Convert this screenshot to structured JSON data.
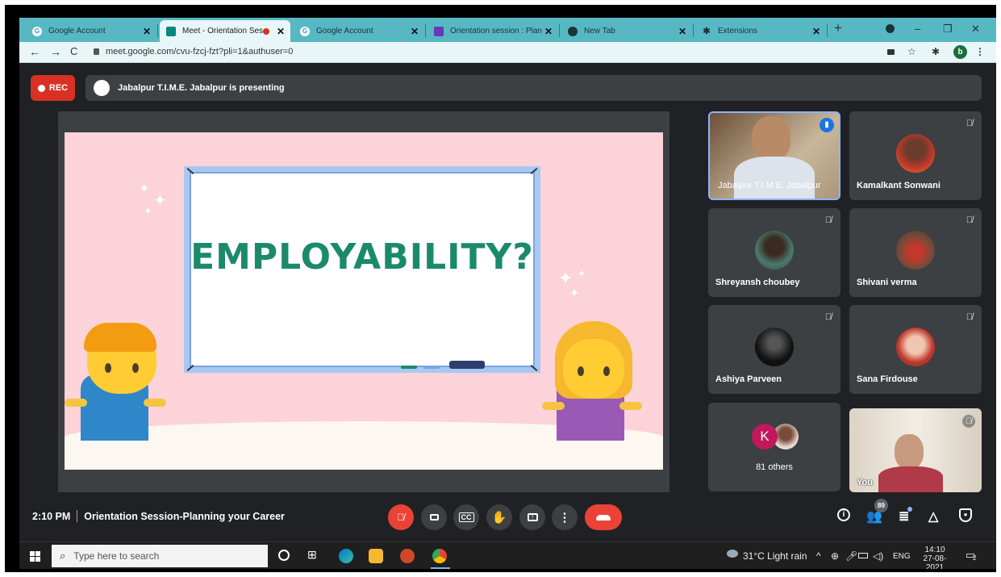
{
  "browser": {
    "tabs": [
      {
        "title": "Google Account",
        "icon": "google-g-icon",
        "active": false
      },
      {
        "title": "Meet - Orientation Ses",
        "icon": "meet-icon",
        "active": true
      },
      {
        "title": "Google Account",
        "icon": "google-g-icon",
        "active": false
      },
      {
        "title": "Orientation session : Planni",
        "icon": "forms-icon",
        "active": false
      },
      {
        "title": "New Tab",
        "icon": "globe-icon",
        "active": false
      },
      {
        "title": "Extensions",
        "icon": "puzzle-icon",
        "active": false
      }
    ],
    "url": "meet.google.com/cvu-fzcj-fzt?pli=1&authuser=0",
    "profile_initial": "b"
  },
  "meet": {
    "rec_label": "REC",
    "presenting_text": "Jabalpur T.I.M.E. Jabalpur is presenting",
    "slide_word": "EMPLOYABILITY?",
    "participants": [
      {
        "name": "Jabalpur T.I.M.E. Jabalpur",
        "speaking": true
      },
      {
        "name": "Kamalkant Sonwani",
        "muted": true
      },
      {
        "name": "Shreyansh choubey",
        "muted": true
      },
      {
        "name": "Shivani verma",
        "muted": true
      },
      {
        "name": "Ashiya Parveen",
        "muted": true
      },
      {
        "name": "Sana Firdouse",
        "muted": true
      },
      {
        "name": "81 others",
        "initial": "K"
      },
      {
        "name": "You",
        "muted": true
      }
    ],
    "time": "2:10 PM",
    "meeting_title": "Orientation Session-Planning your Career",
    "people_count": "89"
  },
  "taskbar": {
    "search_placeholder": "Type here to search",
    "weather": "31°C  Light rain",
    "lang": "ENG",
    "clock_time": "14:10",
    "clock_date": "27-08-2021",
    "notification_count": "2"
  },
  "colors": {
    "accent": "#57b8c3",
    "end_call": "#ea4335",
    "rec": "#d93025"
  }
}
